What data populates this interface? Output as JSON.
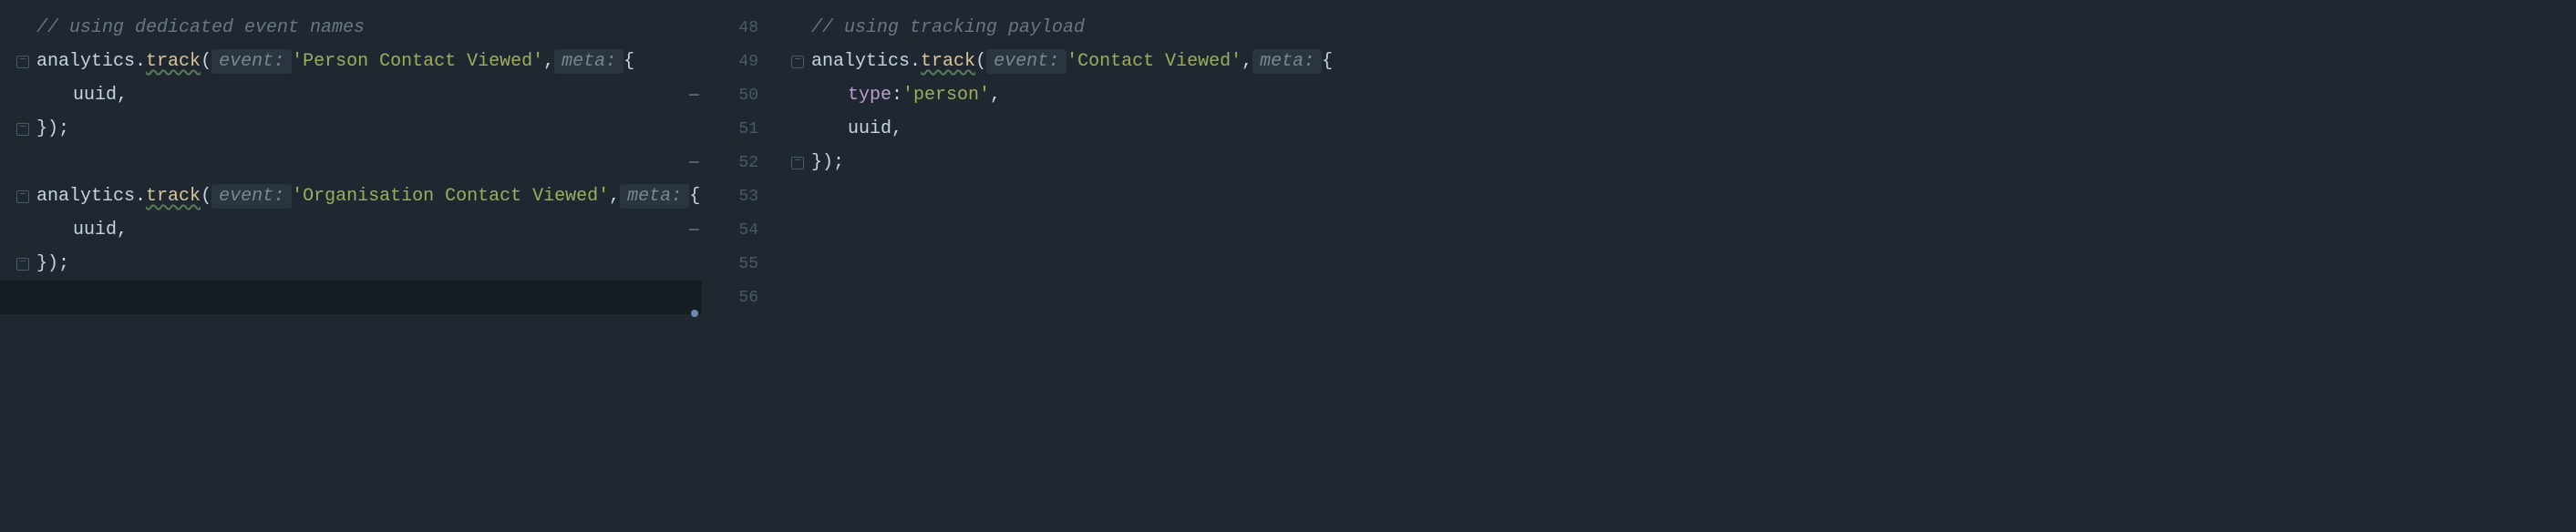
{
  "gutter": {
    "lines": [
      "48",
      "49",
      "50",
      "51",
      "52",
      "53",
      "54",
      "55",
      "56"
    ],
    "markers": {
      "50": "—",
      "52": "—",
      "54": "—"
    }
  },
  "left": {
    "comment": "// using dedicated event names",
    "obj": "analytics",
    "dot": ".",
    "method": "track",
    "open_paren": "(",
    "hint_event": "event:",
    "event1": "'Person Contact Viewed'",
    "comma": ",",
    "hint_meta": "meta:",
    "brace_open": "{",
    "prop_uuid": "uuid",
    "close1": "});",
    "event2": "'Organisation Contact Viewed'",
    "close2": "});"
  },
  "right": {
    "comment": "// using tracking payload",
    "obj": "analytics",
    "dot": ".",
    "method": "track",
    "open_paren": "(",
    "hint_event": "event:",
    "event1": "'Contact Viewed'",
    "comma": ",",
    "hint_meta": "meta:",
    "brace_open": "{",
    "prop_type": "type",
    "colon": ":",
    "val_person": "'person'",
    "prop_uuid": "uuid",
    "close1": "});"
  }
}
